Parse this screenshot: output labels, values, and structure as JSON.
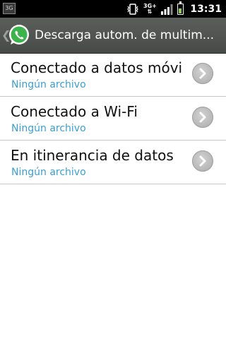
{
  "status_bar": {
    "left_badge": "3G",
    "network": "3G+",
    "time": "13:31",
    "battery_level": 0.55,
    "battery_color": "#8ed14b"
  },
  "action_bar": {
    "title": "Descarga autom. de multimedia",
    "icon": "whatsapp-icon",
    "back_icon": "chevron-left-icon"
  },
  "items": [
    {
      "title": "Conectado a datos móviles",
      "subtitle": "Ningún archivo"
    },
    {
      "title": "Conectado a Wi-Fi",
      "subtitle": "Ningún archivo"
    },
    {
      "title": "En itinerancia de datos",
      "subtitle": "Ningún archivo"
    }
  ],
  "colors": {
    "accent": "#3aa0d2",
    "action_bar": "#4c504c"
  }
}
